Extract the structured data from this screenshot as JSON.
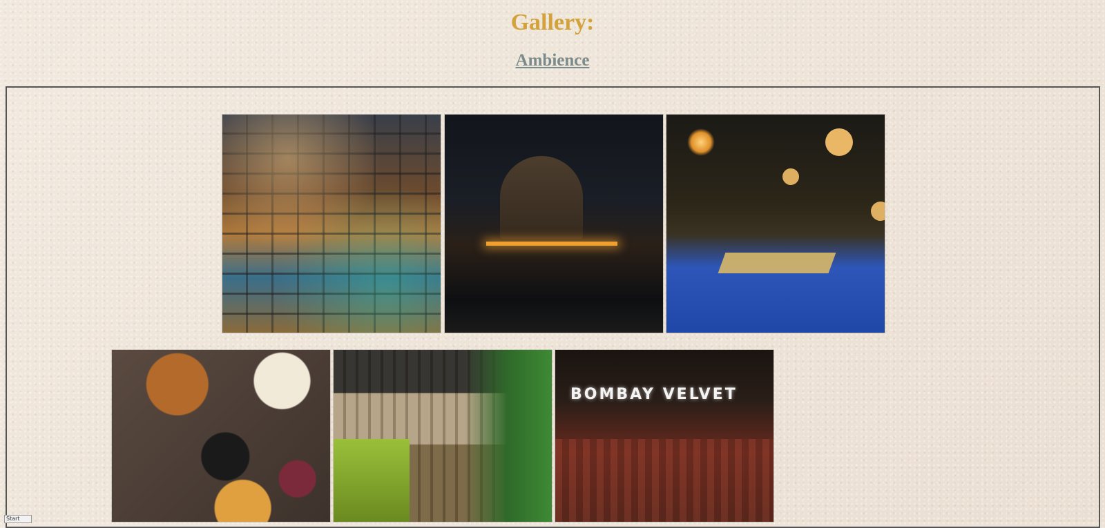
{
  "page": {
    "title": "Gallery:",
    "section_heading": "Ambience"
  },
  "gallery": {
    "images": [
      {
        "name": "cafe-interior-photo"
      },
      {
        "name": "bar-counter-photo"
      },
      {
        "name": "blue-lounge-photo"
      },
      {
        "name": "food-platter-photo"
      },
      {
        "name": "dining-hall-photo"
      },
      {
        "name": "storefront-photo",
        "sign_text": "BOMBAY VELVET"
      }
    ]
  },
  "status_bar": {
    "label": "Start"
  },
  "colors": {
    "title": "#d4a23a",
    "section_heading": "#7b8a8a",
    "background": "#efe5d9",
    "frame_border": "#555555"
  }
}
